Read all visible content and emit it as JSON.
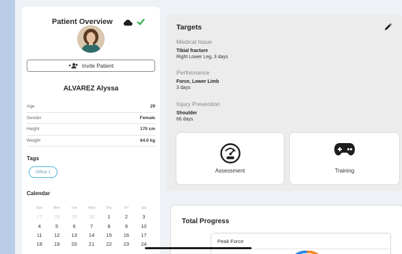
{
  "profile": {
    "title": "Patient Overview",
    "invite_label": "Invite Patient",
    "name": "ALVAREZ Alyssa",
    "stats": [
      {
        "key": "Age",
        "value": "29"
      },
      {
        "key": "Gender",
        "value": "Female"
      },
      {
        "key": "Height",
        "value": "170 cm"
      },
      {
        "key": "Weight",
        "value": "64.0 kg"
      }
    ],
    "tags_title": "Tags",
    "tag": "Office 1",
    "calendar_title": "Calendar",
    "weekdays": [
      "Sun",
      "Mon",
      "Tue",
      "Wed",
      "Thu",
      "Fri",
      "Sat"
    ],
    "weeks": [
      [
        "27",
        "28",
        "29",
        "30",
        "1",
        "2",
        "3"
      ],
      [
        "4",
        "5",
        "6",
        "7",
        "8",
        "9",
        "10"
      ],
      [
        "11",
        "12",
        "13",
        "14",
        "15",
        "16",
        "17"
      ],
      [
        "18",
        "19",
        "20",
        "21",
        "22",
        "23",
        "24"
      ]
    ]
  },
  "targets": {
    "title": "Targets",
    "groups": [
      {
        "category": "Medical Issue",
        "title": "Tibial fracture",
        "detail": "Right Lower Leg, 3 days"
      },
      {
        "category": "Performance",
        "title": "Force, Lower Limb",
        "detail": "3 days"
      },
      {
        "category": "Injury Prevention",
        "title": "Shoulder",
        "detail": "66 days"
      }
    ],
    "cards": [
      {
        "label": "Assessment",
        "icon": "gauge-icon"
      },
      {
        "label": "Training",
        "icon": "gamepad-icon"
      }
    ]
  },
  "progress": {
    "title": "Total Progress",
    "metric": "Peak Force"
  },
  "colors": {
    "sync_check": "#2fb34a",
    "tag_border": "#4ab4d8",
    "background": "#b9cde8"
  }
}
